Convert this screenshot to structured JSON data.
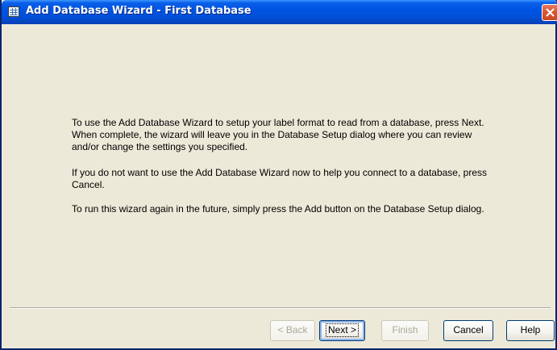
{
  "window": {
    "title": "Add Database Wizard - First Database"
  },
  "content": {
    "paragraph1": "To use the Add Database Wizard to setup your label format to read from a database, press Next.  When complete, the wizard will leave you in the Database Setup dialog where you can review and/or change the settings you specified.",
    "paragraph2": "If you do not want to use the Add Database Wizard now to help you connect to a database, press Cancel.",
    "paragraph3": "To run this wizard again in the future, simply press the Add button on the Database Setup dialog."
  },
  "buttons": {
    "back": "< Back",
    "next": "Next >",
    "finish": "Finish",
    "cancel": "Cancel",
    "help": "Help"
  },
  "icons": {
    "title_icon": "table-icon",
    "close_icon": "close-icon"
  },
  "colors": {
    "titlebar": "#0054e3",
    "close_button": "#d9542f",
    "window_background": "#ece9d8"
  }
}
